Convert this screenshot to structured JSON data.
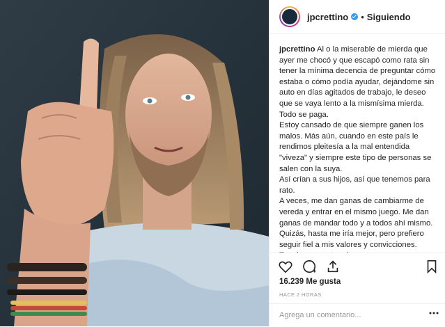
{
  "header": {
    "username": "jpcrettino",
    "separator": "•",
    "follow_status": "Siguiendo"
  },
  "caption": {
    "username": "jpcrettino",
    "paragraphs": [
      "Al o la miserable de mierda que ayer me chocó y que escapó como rata sin tener la mínima decencia de preguntar cómo estaba o cómo podía ayudar, dejándome sin auto en días agitados de trabajo, le deseo que se vaya lento a la mismísima mierda.",
      "Todo se paga.",
      "Estoy cansado de que siempre ganen los malos. Más aún, cuando en este país le rendimos pleitesía a la mal entendida \"viveza\" y siempre este tipo de personas se salen con la suya.",
      "Así crían a sus hijos, así que tenemos para rato.",
      "A veces, me dan ganas de cambiarme de vereda y entrar en el mismo juego. Me dan ganas de mandar todo y a todos ahí mismo. Quizás, hasta me iría mejor, pero prefiero seguir fiel a mis valores y convicciones. Termine como termine."
    ]
  },
  "stats": {
    "likes": "16.239 Me gusta",
    "time": "HACE 2 HORAS"
  },
  "comment": {
    "placeholder": "Agrega un comentario..."
  },
  "icons": {
    "like": "heart-icon",
    "comment": "comment-icon",
    "share": "share-icon",
    "save": "bookmark-icon",
    "more": "more-icon"
  }
}
